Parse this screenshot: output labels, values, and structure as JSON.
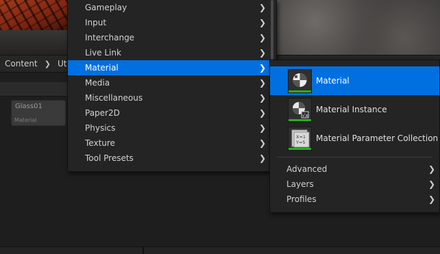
{
  "background": {
    "breadcrumb": {
      "root": "Content",
      "next": "Ut"
    },
    "asset": {
      "name": "Glass01",
      "type": "Material"
    }
  },
  "menu": {
    "items": [
      {
        "label": "Gameplay"
      },
      {
        "label": "Input"
      },
      {
        "label": "Interchange"
      },
      {
        "label": "Live Link"
      },
      {
        "label": "Material",
        "selected": true
      },
      {
        "label": "Media"
      },
      {
        "label": "Miscellaneous"
      },
      {
        "label": "Paper2D"
      },
      {
        "label": "Physics"
      },
      {
        "label": "Texture"
      },
      {
        "label": "Tool Presets"
      }
    ]
  },
  "submenu": {
    "assets": [
      {
        "label": "Material",
        "icon": "material-icon",
        "selected": true
      },
      {
        "label": "Material Instance",
        "icon": "material-instance-icon"
      },
      {
        "label": "Material Parameter Collection",
        "icon": "material-parameter-collection-icon"
      }
    ],
    "categories": [
      {
        "label": "Advanced"
      },
      {
        "label": "Layers"
      },
      {
        "label": "Profiles"
      }
    ],
    "icon_text": {
      "x": "X=1",
      "y": "Y=5"
    }
  },
  "colors": {
    "selection": "#0070e0",
    "menu_bg": "#242424",
    "asset_bar": "#2bb01c"
  }
}
